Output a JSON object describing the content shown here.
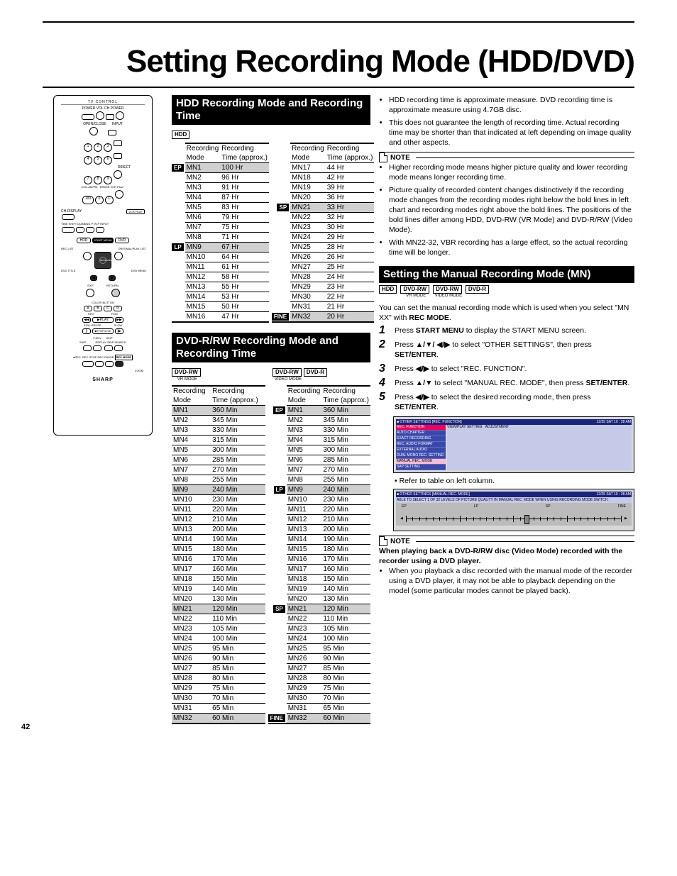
{
  "title": "Setting Recording Mode (HDD/DVD)",
  "pagenum": "42",
  "hdd": {
    "heading": "HDD Recording Mode and Recording Time",
    "tag": "HDD",
    "colhdr": [
      "Recording Mode",
      "Recording Time (approx.)"
    ],
    "left": [
      {
        "m": "MN1",
        "t": "100 Hr",
        "hi": true,
        "label": "EP"
      },
      {
        "m": "MN2",
        "t": "96 Hr"
      },
      {
        "m": "MN3",
        "t": "91 Hr"
      },
      {
        "m": "MN4",
        "t": "87 Hr"
      },
      {
        "m": "MN5",
        "t": "83 Hr"
      },
      {
        "m": "MN6",
        "t": "79 Hr"
      },
      {
        "m": "MN7",
        "t": "75 Hr"
      },
      {
        "m": "MN8",
        "t": "71 Hr"
      },
      {
        "m": "MN9",
        "t": "67 Hr",
        "hi": true,
        "label": "LP"
      },
      {
        "m": "MN10",
        "t": "64 Hr"
      },
      {
        "m": "MN11",
        "t": "61 Hr"
      },
      {
        "m": "MN12",
        "t": "58 Hr"
      },
      {
        "m": "MN13",
        "t": "55 Hr"
      },
      {
        "m": "MN14",
        "t": "53 Hr"
      },
      {
        "m": "MN15",
        "t": "50 Hr"
      },
      {
        "m": "MN16",
        "t": "47 Hr"
      }
    ],
    "right": [
      {
        "m": "MN17",
        "t": "44 Hr"
      },
      {
        "m": "MN18",
        "t": "42 Hr"
      },
      {
        "m": "MN19",
        "t": "39 Hr"
      },
      {
        "m": "MN20",
        "t": "36 Hr"
      },
      {
        "m": "MN21",
        "t": "33 Hr",
        "hi": true,
        "label": "SP"
      },
      {
        "m": "MN22",
        "t": "32 Hr"
      },
      {
        "m": "MN23",
        "t": "30 Hr"
      },
      {
        "m": "MN24",
        "t": "29 Hr"
      },
      {
        "m": "MN25",
        "t": "28 Hr"
      },
      {
        "m": "MN26",
        "t": "26 Hr"
      },
      {
        "m": "MN27",
        "t": "25 Hr"
      },
      {
        "m": "MN28",
        "t": "24 Hr"
      },
      {
        "m": "MN29",
        "t": "23 Hr"
      },
      {
        "m": "MN30",
        "t": "22 Hr"
      },
      {
        "m": "MN31",
        "t": "21 Hr"
      },
      {
        "m": "MN32",
        "t": "20 Hr",
        "hi": true,
        "label": "FINE"
      }
    ]
  },
  "dvd": {
    "heading": "DVD-R/RW Recording Mode and Recording Time",
    "tags_left": {
      "t": "DVD-RW",
      "sub": "VR MODE"
    },
    "tags_right": [
      {
        "t": "DVD-RW",
        "sub": "VIDEO MODE"
      },
      {
        "t": "DVD-R",
        "sub": ""
      }
    ],
    "colhdr": [
      "Recording Mode",
      "Recording Time (approx.)"
    ],
    "left": [
      {
        "m": "MN1",
        "t": "360 Min",
        "hi": true
      },
      {
        "m": "MN2",
        "t": "345 Min"
      },
      {
        "m": "MN3",
        "t": "330 Min"
      },
      {
        "m": "MN4",
        "t": "315 Min"
      },
      {
        "m": "MN5",
        "t": "300 Min"
      },
      {
        "m": "MN6",
        "t": "285 Min"
      },
      {
        "m": "MN7",
        "t": "270 Min"
      },
      {
        "m": "MN8",
        "t": "255 Min"
      },
      {
        "m": "MN9",
        "t": "240 Min",
        "hi": true
      },
      {
        "m": "MN10",
        "t": "230 Min"
      },
      {
        "m": "MN11",
        "t": "220 Min"
      },
      {
        "m": "MN12",
        "t": "210 Min"
      },
      {
        "m": "MN13",
        "t": "200 Min"
      },
      {
        "m": "MN14",
        "t": "190 Min"
      },
      {
        "m": "MN15",
        "t": "180 Min"
      },
      {
        "m": "MN16",
        "t": "170 Min"
      },
      {
        "m": "MN17",
        "t": "160 Min"
      },
      {
        "m": "MN18",
        "t": "150 Min"
      },
      {
        "m": "MN19",
        "t": "140 Min"
      },
      {
        "m": "MN20",
        "t": "130 Min"
      },
      {
        "m": "MN21",
        "t": "120 Min",
        "hi": true
      },
      {
        "m": "MN22",
        "t": "110 Min"
      },
      {
        "m": "MN23",
        "t": "105 Min"
      },
      {
        "m": "MN24",
        "t": "100 Min"
      },
      {
        "m": "MN25",
        "t": "95 Min"
      },
      {
        "m": "MN26",
        "t": "90 Min"
      },
      {
        "m": "MN27",
        "t": "85 Min"
      },
      {
        "m": "MN28",
        "t": "80 Min"
      },
      {
        "m": "MN29",
        "t": "75 Min"
      },
      {
        "m": "MN30",
        "t": "70 Min"
      },
      {
        "m": "MN31",
        "t": "65 Min"
      },
      {
        "m": "MN32",
        "t": "60 Min",
        "hi": true
      }
    ],
    "right": [
      {
        "m": "MN1",
        "t": "360 Min",
        "hi": true,
        "label": "EP"
      },
      {
        "m": "MN2",
        "t": "345 Min"
      },
      {
        "m": "MN3",
        "t": "330 Min"
      },
      {
        "m": "MN4",
        "t": "315 Min"
      },
      {
        "m": "MN5",
        "t": "300 Min"
      },
      {
        "m": "MN6",
        "t": "285 Min"
      },
      {
        "m": "MN7",
        "t": "270 Min"
      },
      {
        "m": "MN8",
        "t": "255 Min"
      },
      {
        "m": "MN9",
        "t": "240 Min",
        "hi": true,
        "label": "LP"
      },
      {
        "m": "MN10",
        "t": "230 Min"
      },
      {
        "m": "MN11",
        "t": "220 Min"
      },
      {
        "m": "MN12",
        "t": "210 Min"
      },
      {
        "m": "MN13",
        "t": "200 Min"
      },
      {
        "m": "MN14",
        "t": "190 Min"
      },
      {
        "m": "MN15",
        "t": "180 Min"
      },
      {
        "m": "MN16",
        "t": "170 Min"
      },
      {
        "m": "MN17",
        "t": "160 Min"
      },
      {
        "m": "MN18",
        "t": "150 Min"
      },
      {
        "m": "MN19",
        "t": "140 Min"
      },
      {
        "m": "MN20",
        "t": "130 Min"
      },
      {
        "m": "MN21",
        "t": "120 Min",
        "hi": true,
        "label": "SP"
      },
      {
        "m": "MN22",
        "t": "110 Min"
      },
      {
        "m": "MN23",
        "t": "105 Min"
      },
      {
        "m": "MN24",
        "t": "100 Min"
      },
      {
        "m": "MN25",
        "t": "95 Min"
      },
      {
        "m": "MN26",
        "t": "90 Min"
      },
      {
        "m": "MN27",
        "t": "85 Min"
      },
      {
        "m": "MN28",
        "t": "80 Min"
      },
      {
        "m": "MN29",
        "t": "75 Min"
      },
      {
        "m": "MN30",
        "t": "70 Min"
      },
      {
        "m": "MN31",
        "t": "65 Min"
      },
      {
        "m": "MN32",
        "t": "60 Min",
        "hi": true,
        "label": "FINE"
      }
    ]
  },
  "right": {
    "bullets1": [
      "HDD recording time is approximate measure. DVD recording time is approximate measure using 4.7GB disc.",
      "This does not guarantee the length of recording time. Actual recording time may be shorter than that indicated at left depending on image quality and other aspects."
    ],
    "note1_hdr": "NOTE",
    "note1": [
      "Higher recording mode means higher picture quality and lower recording mode means longer recording time.",
      "Picture quality of recorded content changes distinctively if the recording mode changes from the recording modes right below the bold lines in left chart and recording modes right above the bold lines. The positions of the bold lines differ among HDD, DVD-RW (VR Mode) and DVD-R/RW (Video Mode).",
      "With MN22-32, VBR recording has a large effect, so the actual recording time will be longer."
    ],
    "heading2": "Setting the Manual Recording Mode (MN)",
    "tags2": [
      {
        "t": "HDD",
        "sub": ""
      },
      {
        "t": "DVD-RW",
        "sub": "VR MODE"
      },
      {
        "t": "DVD-RW",
        "sub": "VIDEO MODE"
      },
      {
        "t": "DVD-R",
        "sub": ""
      }
    ],
    "intro": "You can set the manual recording mode which is used when you select \"MN XX\" with ",
    "intro_b": "REC MODE",
    "steps": [
      {
        "n": "1",
        "t": "Press <b>START MENU</b> to display the START MENU screen."
      },
      {
        "n": "2",
        "t": "Press <b>▲/▼/ ◀/▶</b> to select \"OTHER SETTINGS\", then press <b>SET/ENTER</b>."
      },
      {
        "n": "3",
        "t": "Press <b>◀/▶</b> to select \"REC. FUNCTION\"."
      },
      {
        "n": "4",
        "t": "Press <b>▲/▼</b> to select \"MANUAL REC. MODE\", then press <b>SET/ENTER</b>."
      },
      {
        "n": "5",
        "t": "Press <b>◀/▶</b> to select the desired recording mode, then press <b>SET/ENTER</b>."
      }
    ],
    "step5sub": "Refer to table on left column.",
    "screen1": {
      "title": "OTHER SETTINGS [REC. FUNCTION]",
      "time": "12/25 SAT 10 : 28 AM",
      "cols": [
        "VIEW/PLAY SETTING",
        "ADJUSTMENT"
      ],
      "items": [
        "REC. FUNCTION",
        "AUTO CHAPTER",
        "EXACT RECORDING",
        "REC. AUDIO FORMAT",
        "EXTERNAL AUDIO",
        "DUAL MONO REC. SETTING",
        "MANUAL REC. MODE",
        "SAP SETTING"
      ]
    },
    "screen2": {
      "title": "OTHER SETTINGS [MANUAL REC. MODE]",
      "time": "12/25 SAT 10 : 28 AM",
      "desc": "ABLE TO SELECT 1 OF 32 LEVELS OF PICTURE QUALITY IN MANUAL REC. MODE WHEN USING RECORDING MODE SWITCH.",
      "labels": [
        "EP",
        "LP",
        "SP",
        "FINE"
      ]
    },
    "note2_hdr": "NOTE",
    "note2_bold": "When playing back a DVD-R/RW disc (Video Mode) recorded with the recorder using a DVD player.",
    "note2_bul": "When you playback a disc recorded with the manual mode of the recorder using a DVD player, it may not be able to playback depending on the model (some particular modes cannot be played back)."
  },
  "remote": {
    "top": "TV CONTROL",
    "labels": [
      "POWER",
      "VOL",
      "CH",
      "POWER",
      "OPEN/CLOSE",
      "INPUT",
      "DIRECT",
      "DVD.AM/PM",
      "ERASE",
      "VCR Plus+",
      "CH.DISPLAY",
      "TIME SHIFT",
      "DUBBING",
      "P IN P",
      "INPUT",
      "HDD",
      "START MENU",
      "DVD",
      "REC LIST",
      "ORIGINAL/PLAY LIST",
      "DVD TITLE",
      "DVD MENU",
      "SET/ENTER",
      "EXIT",
      "RETURN",
      "COLOR BUTTON",
      "REV",
      "FWD",
      "PLAY",
      "STILL/PAUSE",
      "SLOW",
      "STOP/LIVE",
      "F.ADV",
      "SKIP",
      "REPLAY",
      "SKIP SEARCH",
      "REC",
      "REC STOP",
      "REC PAUSE",
      "REC MODE",
      "ZOOM",
      "SHARP"
    ]
  }
}
